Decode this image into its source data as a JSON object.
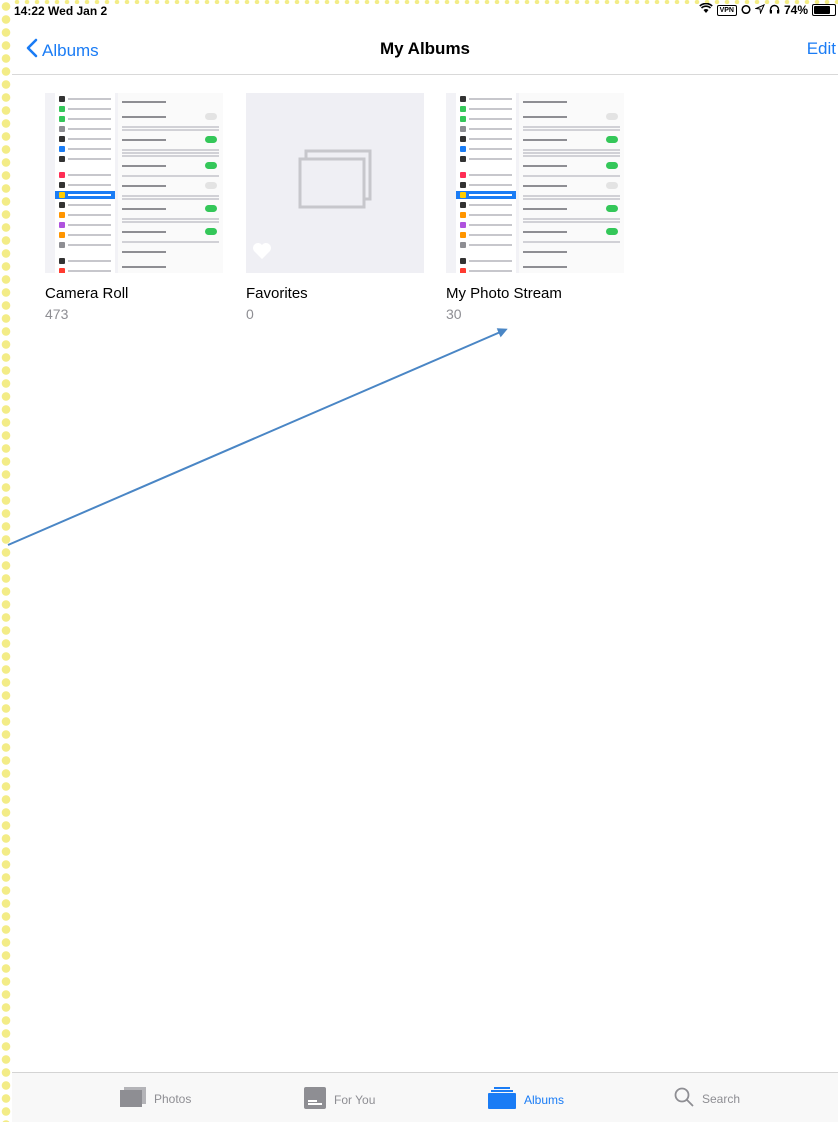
{
  "status": {
    "time": "14:22",
    "date": "Wed Jan 2",
    "vpn": "VPN",
    "battery": "74%"
  },
  "nav": {
    "back_label": "Albums",
    "title": "My Albums",
    "edit_label": "Edit"
  },
  "albums": [
    {
      "name": "Camera Roll",
      "count": "473"
    },
    {
      "name": "Favorites",
      "count": "0"
    },
    {
      "name": "My Photo Stream",
      "count": "30"
    }
  ],
  "tabs": [
    {
      "label": "Photos",
      "icon": "photos-tab-icon",
      "active": false
    },
    {
      "label": "For You",
      "icon": "for-you-tab-icon",
      "active": false
    },
    {
      "label": "Albums",
      "icon": "albums-tab-icon",
      "active": true
    },
    {
      "label": "Search",
      "icon": "search-icon",
      "active": false
    }
  ],
  "colors": {
    "accent": "#1a7cf5",
    "annotation_arrow": "#4a86c5",
    "secondary_text": "#8e8e93"
  }
}
